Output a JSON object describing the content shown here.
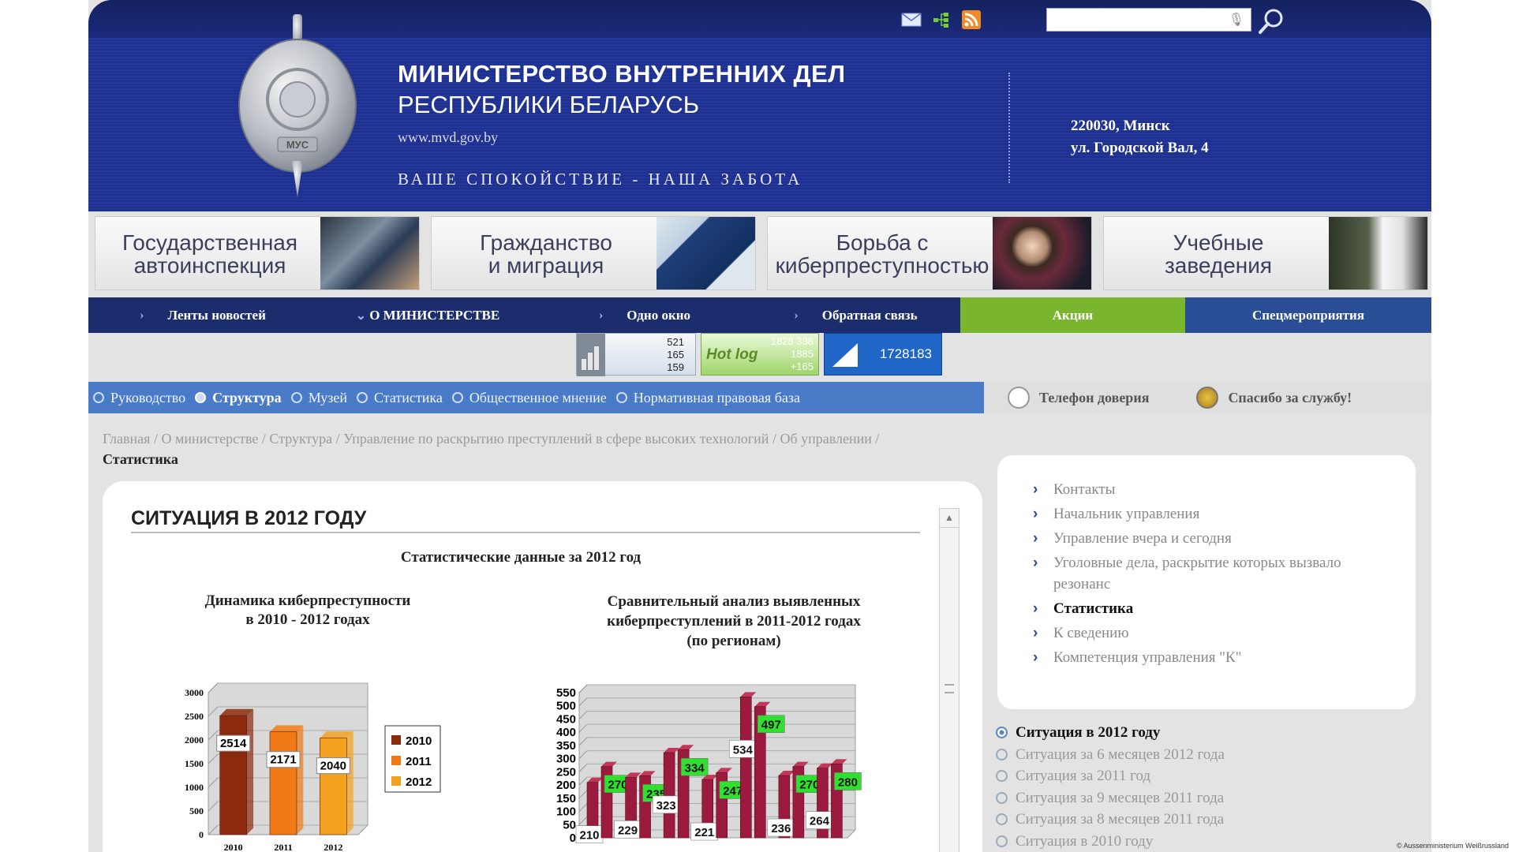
{
  "header": {
    "title_line1": "МИНИСТЕРСТВО ВНУТРЕННИХ ДЕЛ",
    "title_line2": "РЕСПУБЛИКИ БЕЛАРУСЬ",
    "url": "www.mvd.gov.by",
    "slogan": "ВАШЕ СПОКОЙСТВИЕ - НАША ЗАБОТА",
    "address_line1": "220030, Минск",
    "address_line2": "ул. Городской Вал, 4",
    "emblem_text": "МУС",
    "icons": [
      "mail-icon",
      "sitemap-icon",
      "rss-icon"
    ],
    "search_placeholder": "",
    "colors": {
      "header_bg": "#1e2f8c",
      "nav_bg": "#1c2d6e",
      "accent_green": "#7ab62d",
      "subnav_bg": "#4a7bc6"
    }
  },
  "banners": [
    {
      "line1": "Государственная",
      "line2": "автоинспекция"
    },
    {
      "line1": "Гражданство",
      "line2": "и миграция"
    },
    {
      "line1": "Борьба с",
      "line2": "киберпреступностью"
    },
    {
      "line1": "Учебные",
      "line2": "заведения"
    }
  ],
  "nav": {
    "items": [
      "Ленты новостей",
      "О МИНИСТЕРСТВЕ",
      "Одно окно",
      "Обратная связь",
      "Акции",
      "Спецмероприятия"
    ]
  },
  "counters": {
    "c1": [
      "521",
      "165",
      "159"
    ],
    "c2_label": "Hot log",
    "c2": [
      "1828 338",
      "1885",
      "+165"
    ],
    "c3": "1728183"
  },
  "subnav": {
    "items": [
      "Руководство",
      "Структура",
      "Музей",
      "Статистика",
      "Общественное мнение",
      "Нормативная правовая база"
    ],
    "active_index": 1
  },
  "side_links": [
    "Телефон доверия",
    "Спасибо за службу!"
  ],
  "breadcrumb": {
    "items": [
      "Главная",
      "О министерстве",
      "Структура",
      "Управление по раскрытию преступлений в сфере высоких технологий",
      "Об управлении"
    ],
    "current": "Статистика"
  },
  "main": {
    "title": "СИТУАЦИЯ В 2012 ГОДУ",
    "stats_heading": "Статистические данные за 2012 год",
    "chart1_title_l1": "Динамика киберпреступности",
    "chart1_title_l2": "в 2010 - 2012 годах",
    "chart2_title_l1": "Сравнительный анализ выявленных",
    "chart2_title_l2": "киберпреступлений в 2011-2012 годах",
    "chart2_title_l3": "(по регионам)"
  },
  "sidebar": {
    "menu": [
      "Контакты",
      "Начальник управления",
      "Управление вчера и сегодня",
      "Уголовные дела, раскрытие которых вызвало резонанс",
      "Статистика",
      "К сведению",
      "Компетенция управления \"К\""
    ],
    "active_menu_index": 4,
    "situations": [
      "Ситуация в 2012 году",
      "Ситуация за 6 месяцев 2012 года",
      "Ситуация за 2011 год",
      "Ситуация за 9 месяцев 2011 года",
      "Ситуация за 8 месяцев 2011 года",
      "Ситуация в 2010 году"
    ],
    "active_situation_index": 0
  },
  "credit": "© Aussenministerium Weißrussland",
  "chart_data": [
    {
      "type": "bar",
      "categories": [
        "2010",
        "2011",
        "2012"
      ],
      "values": [
        2514,
        2171,
        2040
      ],
      "ylim": [
        0,
        3000
      ],
      "yticks": [
        0,
        500,
        1000,
        1500,
        2000,
        2500,
        3000
      ],
      "legend": [
        "2010",
        "2011",
        "2012"
      ],
      "legend_position": "right",
      "colors": [
        "#8b2a0c",
        "#f07a16",
        "#f3a11e"
      ],
      "grid": true
    },
    {
      "type": "bar",
      "series": [
        {
          "name": "2011",
          "values": [
            210,
            229,
            323,
            221,
            534,
            236,
            264
          ],
          "color": "#9b1b3e",
          "label_color": "#ffffff"
        },
        {
          "name": "2012",
          "values": [
            270,
            235,
            334,
            247,
            497,
            270,
            280
          ],
          "color": "#9b1b3e",
          "label_color": "#2fe02f"
        }
      ],
      "categories_count": 7,
      "ylim": [
        0,
        550
      ],
      "yticks": [
        0,
        50,
        100,
        150,
        200,
        250,
        300,
        350,
        400,
        450,
        500,
        550
      ],
      "grid": true
    }
  ]
}
